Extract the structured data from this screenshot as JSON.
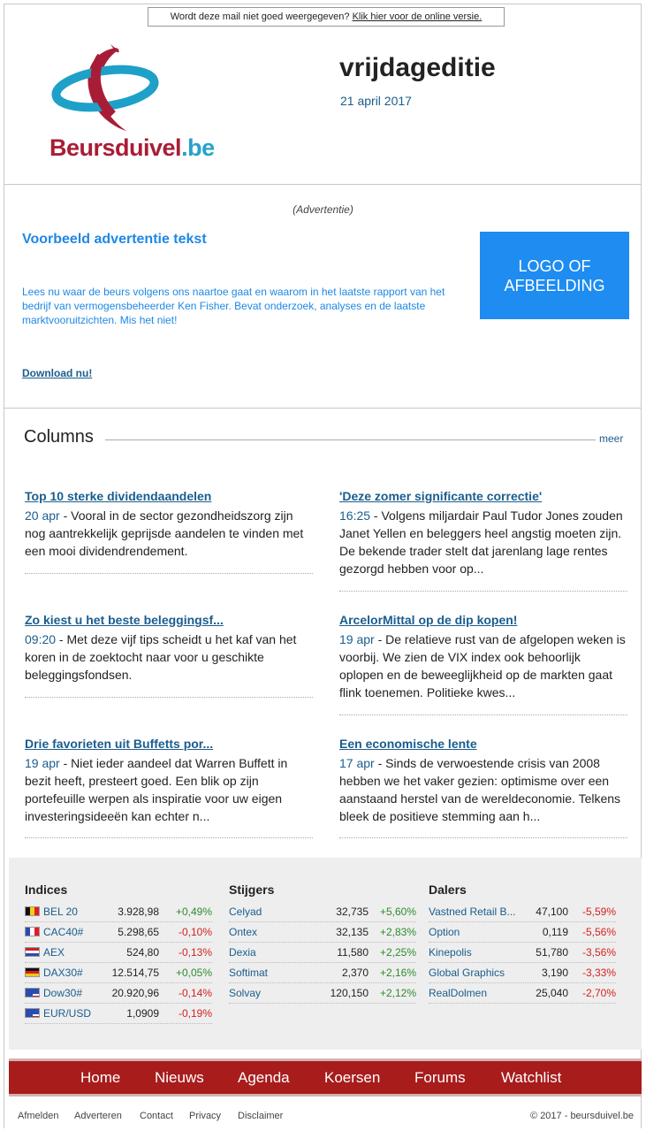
{
  "header": {
    "view_notice": "Wordt deze mail niet goed weergegeven?",
    "view_link": "Klik hier voor de online versie.",
    "brand_name": "Beursduivel",
    "brand_dot": ".",
    "brand_tld": "be",
    "edition": "vrijdageditie",
    "date": "21 april 2017"
  },
  "ad": {
    "label": "(Advertentie)",
    "title": "Voorbeeld advertentie tekst",
    "text": "Lees nu waar de beurs volgens ons naartoe gaat en waarom in het laatste rapport van het bedrijf van vermogensbeheerder Ken Fisher. Bevat onderzoek, analyses en de laatste marktvooruitzichten. Mis het niet!",
    "link": "Download nu!",
    "box_line1": "LOGO OF",
    "box_line2": "AFBEELDING"
  },
  "columns": {
    "heading": "Columns",
    "more": "meer",
    "articles": [
      {
        "title": "Top 10 sterke dividendaandelen",
        "time": "20 apr",
        "text": " - Vooral in de sector gezondheidszorg zijn nog aantrekkelijk geprijsde aandelen te vinden met een mooi dividendrendement."
      },
      {
        "title": "'Deze zomer significante correctie'",
        "time": "16:25",
        "text": " - Volgens miljardair Paul Tudor Jones zouden Janet Yellen en beleggers heel angstig moeten zijn. De bekende trader stelt dat jarenlang lage rentes gezorgd hebben voor op..."
      },
      {
        "title": "Zo kiest u het beste beleggingsf...",
        "time": "09:20",
        "text": " - Met deze vijf tips scheidt u het kaf van het koren in de zoektocht naar voor u geschikte beleggingsfondsen."
      },
      {
        "title": "ArcelorMittal op de dip kopen!",
        "time": "19 apr",
        "text": " - De relatieve rust van de afgelopen weken is voorbij. We zien de VIX index ook behoorlijk oplopen en de beweeglijkheid op de markten gaat flink toenemen. Politieke kwes..."
      },
      {
        "title": "Drie favorieten uit Buffetts por...",
        "time": "19 apr",
        "text": " - Niet ieder aandeel dat Warren Buffett in bezit heeft, presteert goed. Een blik op zijn portefeuille werpen als inspiratie voor uw eigen investeringsideeën kan echter n..."
      },
      {
        "title": "Een economische lente",
        "time": "17 apr",
        "text": " - Sinds de verwoestende crisis van 2008 hebben we het vaker gezien: optimisme over een aanstaand herstel van de wereldeconomie. Telkens bleek de positieve stemming aan h..."
      }
    ]
  },
  "markets": {
    "indices": {
      "heading": "Indices",
      "rows": [
        {
          "name": "BEL 20",
          "value": "3.928,98",
          "change": "+0,49%",
          "flag": "belgium-flag-icon"
        },
        {
          "name": "CAC40#",
          "value": "5.298,65",
          "change": "-0,10%",
          "flag": "france-flag-icon"
        },
        {
          "name": "AEX",
          "value": "524,80",
          "change": "-0,13%",
          "flag": "netherlands-flag-icon"
        },
        {
          "name": "DAX30#",
          "value": "12.514,75",
          "change": "+0,05%",
          "flag": "germany-flag-icon"
        },
        {
          "name": "Dow30#",
          "value": "20.920,96",
          "change": "-0,14%",
          "flag": "usa-flag-icon"
        },
        {
          "name": "EUR/USD",
          "value": "1,0909",
          "change": "-0,19%",
          "flag": "eur-usd-flag-icon"
        }
      ]
    },
    "gainers": {
      "heading": "Stijgers",
      "rows": [
        {
          "name": "Celyad",
          "value": "32,735",
          "change": "+5,60%"
        },
        {
          "name": "Ontex",
          "value": "32,135",
          "change": "+2,83%"
        },
        {
          "name": "Dexia",
          "value": "11,580",
          "change": "+2,25%"
        },
        {
          "name": "Softimat",
          "value": "2,370",
          "change": "+2,16%"
        },
        {
          "name": "Solvay",
          "value": "120,150",
          "change": "+2,12%"
        }
      ]
    },
    "losers": {
      "heading": "Dalers",
      "rows": [
        {
          "name": "Vastned Retail B...",
          "value": "47,100",
          "change": "-5,59%"
        },
        {
          "name": "Option",
          "value": "0,119",
          "change": "-5,56%"
        },
        {
          "name": "Kinepolis",
          "value": "51,780",
          "change": "-3,56%"
        },
        {
          "name": "Global Graphics",
          "value": "3,190",
          "change": "-3,33%"
        },
        {
          "name": "RealDolmen",
          "value": "25,040",
          "change": "-2,70%"
        }
      ]
    },
    "colors": {
      "positive": "#2e8b2e",
      "negative": "#d42020"
    }
  },
  "nav": [
    "Home",
    "Nieuws",
    "Agenda",
    "Koersen",
    "Forums",
    "Watchlist"
  ],
  "footer": {
    "links": [
      "Afmelden",
      "Adverteren",
      "Contact",
      "Privacy",
      "Disclaimer"
    ],
    "copyright": "© 2017 - beursduivel.be"
  },
  "colors": {
    "brand_red": "#a81d36",
    "brand_blue": "#27a2c7",
    "link_blue": "#1a5d8e",
    "ad_blue": "#1e88e5",
    "nav_red": "#a81c1c"
  }
}
